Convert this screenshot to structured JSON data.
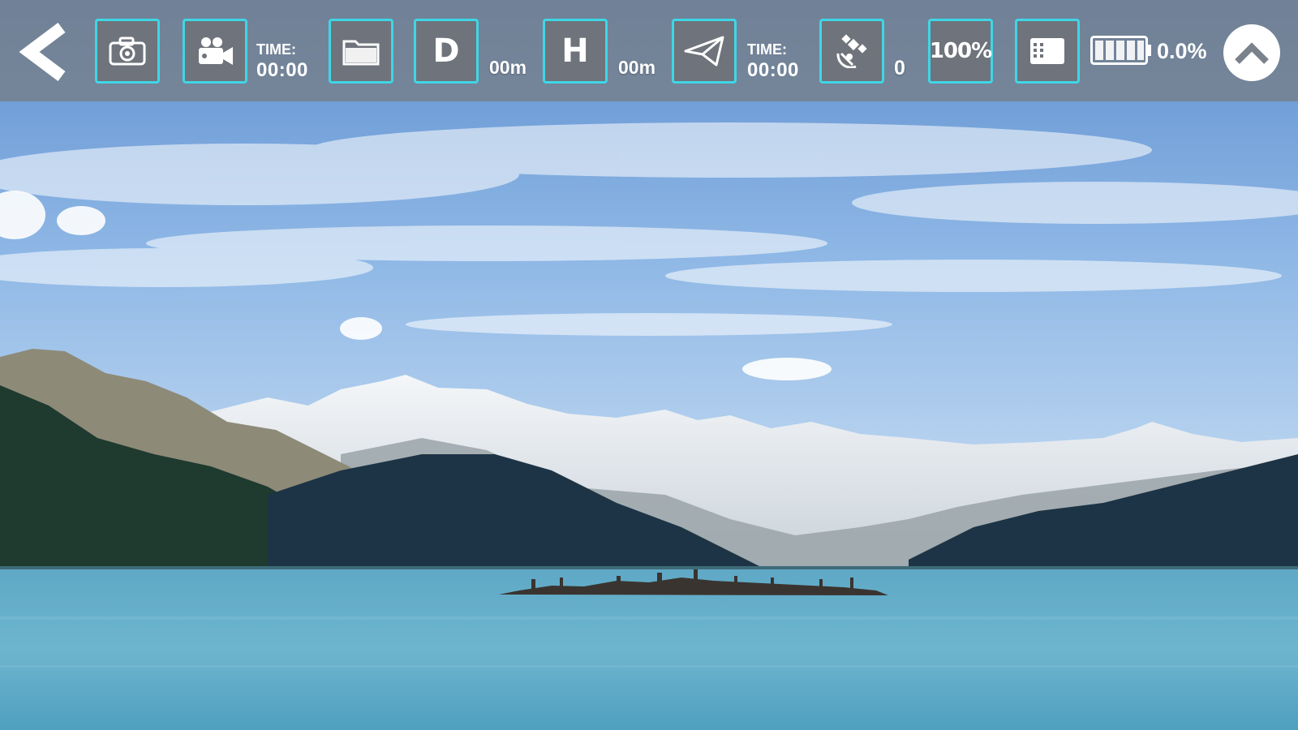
{
  "toolbar": {
    "back_icon": "chevron-left-icon",
    "photo_icon": "camera-icon",
    "video_icon": "video-camera-icon",
    "record_time": {
      "label": "TIME:",
      "value": "00:00"
    },
    "gallery_icon": "folder-icon",
    "distance": {
      "letter": "D",
      "value": "00m"
    },
    "height": {
      "letter": "H",
      "value": "00m"
    },
    "flight_icon": "paper-plane-icon",
    "flight_time": {
      "label": "TIME:",
      "value": "00:00"
    },
    "satellite": {
      "icon": "satellite-icon",
      "count": "0"
    },
    "zoom_label": "100%",
    "sd_card_icon": "sd-card-icon",
    "battery": {
      "icon": "battery-icon",
      "percent": "0.0%"
    },
    "collapse_icon": "chevron-up-icon"
  },
  "colors": {
    "toolbar_bg": "#767e8a",
    "tile_bg": "#6f737b",
    "tile_border": "#3fd6e6",
    "text": "#ffffff"
  },
  "feed": {
    "scene": "mountain lake camera view"
  }
}
